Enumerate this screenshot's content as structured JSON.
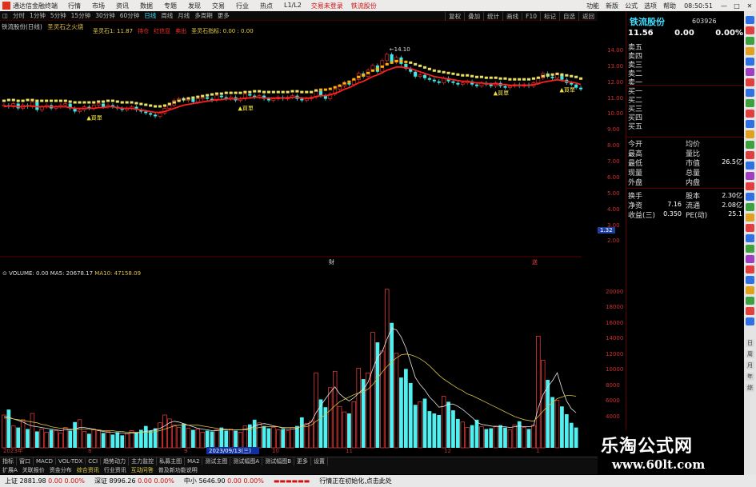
{
  "app": {
    "title": "通达信金融终端",
    "menu": [
      "行情",
      "市场",
      "资讯",
      "数据",
      "专题",
      "发现",
      "交易",
      "行业",
      "热点",
      "L1/L2"
    ],
    "login_links": [
      "交易未登录",
      "铁流股份"
    ],
    "right_menu": [
      "功能",
      "新版",
      "公式",
      "选项",
      "帮助"
    ],
    "clock": "08:50:51"
  },
  "period_tabs": [
    "分时",
    "1分钟",
    "5分钟",
    "15分钟",
    "30分钟",
    "60分钟",
    "日线",
    "周线",
    "月线",
    "多周期",
    "更多"
  ],
  "active_period": "日线",
  "chart_tools": [
    "复权",
    "叠加",
    "统计",
    "画线",
    "F10",
    "标记",
    "自选",
    "返回"
  ],
  "chart_header": {
    "title": "铁流股份(日线)",
    "formula": "圣灵石之火烧",
    "indicators": [
      {
        "label": "圣灵石1: 11.87",
        "color": "#e8d040"
      },
      {
        "label": "持仓",
        "color": "#ff3030"
      },
      {
        "label": "红信显",
        "color": "#ff3030"
      },
      {
        "label": "卖出",
        "color": "#ff3030"
      },
      {
        "label": "圣灵石指标: 0.00 : 0.00",
        "color": "#e8d040"
      }
    ]
  },
  "price_axis": [
    "14.00",
    "13.00",
    "12.00",
    "11.00",
    "10.00",
    "9.00",
    "8.00",
    "7.00",
    "6.00",
    "5.00",
    "4.00",
    "3.00",
    "2.00"
  ],
  "price_badge": "1.32",
  "annotations": {
    "high_label": "14.10",
    "buy_labels": [
      "▲買單",
      "▲買單",
      "▲買單",
      "▲買單"
    ],
    "event_markers": [
      "財",
      "送"
    ]
  },
  "volume_header": {
    "vol": "VOLUME: 0.00",
    "ma5": "MA5: 20678.17",
    "ma10": "MA10: 47158.09"
  },
  "volume_axis": [
    "20000",
    "18000",
    "16000",
    "14000",
    "12000",
    "10000",
    "8000",
    "6000",
    "4000"
  ],
  "time_axis": {
    "labels": [
      "2023年",
      "8",
      "9",
      "10",
      "11",
      "12",
      "1"
    ],
    "cursor_date": "2023/09/13(三)"
  },
  "bottom_tabs": [
    "指标",
    "窗口",
    "MACD",
    "VOL-TDX",
    "CCI",
    "趋势动力",
    "主力监控",
    "私募主图",
    "MA2",
    "测试主图",
    "测试幅图A",
    "测试幅图B",
    "更多",
    "设置"
  ],
  "bottom_tabs2": [
    {
      "label": "扩展A",
      "hl": false
    },
    {
      "label": "关联报价",
      "hl": false
    },
    {
      "label": "资金分布",
      "hl": false
    },
    {
      "label": "综合资讯",
      "hl": true
    },
    {
      "label": "行业资讯",
      "hl": false
    },
    {
      "label": "互动问答",
      "hl": true
    },
    {
      "label": "普及新功能说明",
      "hl": false
    }
  ],
  "status": {
    "sh": "上证 2881.98",
    "sh_chg": "0.00",
    "sh_pct": "0.00%",
    "sz": "深证 8996.26",
    "sz_chg": "0.00",
    "sz_pct": "0.00%",
    "zx": "中小 5646.90",
    "zx_chg": "0.00",
    "zx_pct": "0.00%",
    "message": "行情正在初始化,点击此处",
    "dashes": "▬▬▬▬▬▬"
  },
  "quote": {
    "name": "铁流股份",
    "code": "603926",
    "price": "11.56",
    "change": "0.00",
    "pct": "0.00%",
    "order_book": [
      "卖五",
      "卖四",
      "卖三",
      "卖二",
      "卖一",
      "买一",
      "买二",
      "买三",
      "买四",
      "买五"
    ],
    "stats_left": [
      "今开",
      "最高",
      "最低",
      "现量",
      "外盘"
    ],
    "stats_right": [
      "均价",
      "量比",
      "市值",
      "总量",
      "内盘"
    ],
    "market_value": "26.5亿",
    "extra": [
      {
        "l": "换手",
        "lv": "",
        "r": "股本",
        "rv": "2.30亿"
      },
      {
        "l": "净资",
        "lv": "7.16",
        "r": "流通",
        "rv": "2.08亿"
      },
      {
        "l": "收益(三)",
        "lv": "0.350",
        "r": "PE(动)",
        "rv": "25.1"
      }
    ]
  },
  "side_strip": [
    "日",
    "周",
    "月",
    "年",
    "综"
  ],
  "watermark": {
    "cn": "乐淘公式网",
    "url": "www.60lt.com"
  },
  "colors": {
    "up": "#ff3030",
    "down": "#40e8e8",
    "ma_price": "#e8e060",
    "ma_red": "#ff2020",
    "vol_up": "#ff4040",
    "vol_down": "#50f0f0",
    "ma5": "#e8e8e8",
    "ma10": "#d8c040"
  },
  "chart_data": {
    "type": "candlestick",
    "title": "铁流股份(日线)",
    "ylim": [
      1.32,
      14.6
    ],
    "price": [
      10.6,
      10.5,
      10.7,
      10.4,
      10.6,
      10.5,
      10.8,
      10.3,
      10.5,
      10.6,
      10.4,
      10.5,
      10.6,
      10.7,
      10.4,
      10.2,
      10.3,
      10.5,
      10.4,
      10.6,
      10.7,
      10.5,
      10.6,
      10.5,
      10.4,
      10.3,
      10.4,
      10.5,
      10.3,
      10.2,
      10.1,
      10.0,
      9.9,
      10.1,
      10.4,
      10.6,
      10.9,
      11.0,
      10.9,
      11.0,
      10.8,
      11.0,
      11.1,
      11.0,
      10.9,
      11.2,
      11.1,
      11.0,
      11.1,
      10.9,
      11.0,
      11.3,
      11.2,
      11.1,
      11.2,
      11.0,
      10.9,
      11.0,
      11.1,
      11.0,
      11.1,
      11.2,
      11.0,
      10.9,
      11.0,
      11.1,
      11.5,
      11.2,
      11.0,
      11.3,
      11.6,
      11.8,
      12.0,
      11.9,
      12.2,
      12.6,
      12.4,
      12.8,
      13.1,
      12.7,
      13.4,
      13.8,
      13.3,
      13.6,
      13.2,
      12.9,
      12.7,
      12.4,
      12.5,
      12.3,
      12.2,
      12.1,
      12.0,
      12.3,
      12.1,
      12.0,
      11.9,
      12.0,
      12.1,
      11.9,
      11.8,
      12.0,
      11.9,
      11.8,
      12.0,
      11.8,
      11.7,
      11.8,
      11.9,
      11.8,
      11.9,
      11.8,
      12.0,
      12.3,
      12.6,
      12.4,
      12.3,
      12.5,
      12.2,
      12.0,
      11.9,
      11.7,
      11.6
    ],
    "ma": [
      10.5,
      10.55,
      10.55,
      10.5,
      10.5,
      10.55,
      10.55,
      10.5,
      10.5,
      10.5,
      10.5,
      10.5,
      10.5,
      10.5,
      10.45,
      10.4,
      10.4,
      10.4,
      10.4,
      10.4,
      10.45,
      10.45,
      10.5,
      10.5,
      10.45,
      10.4,
      10.4,
      10.4,
      10.35,
      10.3,
      10.25,
      10.2,
      10.15,
      10.15,
      10.2,
      10.3,
      10.4,
      10.5,
      10.6,
      10.65,
      10.7,
      10.75,
      10.8,
      10.85,
      10.9,
      10.95,
      10.95,
      11.0,
      11.0,
      11.0,
      11.0,
      11.05,
      11.05,
      11.1,
      11.1,
      11.05,
      11.05,
      11.05,
      11.05,
      11.05,
      11.05,
      11.1,
      11.1,
      11.05,
      11.05,
      11.05,
      11.15,
      11.2,
      11.2,
      11.25,
      11.35,
      11.45,
      11.6,
      11.7,
      11.85,
      12.0,
      12.1,
      12.25,
      12.4,
      12.5,
      12.65,
      12.8,
      12.9,
      13.0,
      13.0,
      12.95,
      12.9,
      12.8,
      12.7,
      12.6,
      12.5,
      12.4,
      12.35,
      12.3,
      12.25,
      12.2,
      12.15,
      12.1,
      12.1,
      12.05,
      12.0,
      12.0,
      11.95,
      11.95,
      11.95,
      11.9,
      11.9,
      11.85,
      11.85,
      11.85,
      11.85,
      11.85,
      11.9,
      11.95,
      12.05,
      12.1,
      12.15,
      12.2,
      12.15,
      12.1,
      12.05,
      12.0,
      11.9
    ],
    "volume": [
      4200,
      4900,
      2800,
      2600,
      3600,
      2400,
      4400,
      2100,
      2400,
      2000,
      2300,
      2200,
      1900,
      2600,
      2200,
      3300,
      3600,
      2100,
      1800,
      2400,
      2200,
      1900,
      2100,
      1700,
      2000,
      1600,
      1800,
      2200,
      1900,
      2300,
      2800,
      2200,
      2500,
      3200,
      4200,
      3700,
      2900,
      2600,
      3100,
      2500,
      2300,
      2400,
      2000,
      2200,
      2100,
      2300,
      2600,
      2200,
      2400,
      2200,
      2000,
      2800,
      3000,
      3600,
      3200,
      2800,
      2500,
      2600,
      2300,
      2400,
      2200,
      2600,
      2800,
      3900,
      3100,
      3400,
      9600,
      6200,
      5200,
      7700,
      9800,
      5300,
      4600,
      4400,
      5900,
      10200,
      8800,
      9600,
      14800,
      13500,
      12400,
      20300,
      16000,
      12100,
      9000,
      10100,
      8300,
      5500,
      5900,
      6300,
      4700,
      4400,
      4200,
      6600,
      5900,
      4800,
      3700,
      3300,
      2600,
      2900,
      3600,
      2700,
      2400,
      2500,
      2800,
      2900,
      2600,
      2300,
      2900,
      3400,
      2600,
      2400,
      2900,
      14300,
      11200,
      8700,
      6500,
      6100,
      5300,
      4300,
      3200,
      2600
    ],
    "ma5": [
      4000,
      3900,
      3700,
      3500,
      3300,
      3000,
      2800,
      2700,
      2600,
      2500,
      2400,
      2300,
      2200,
      2300,
      2300,
      2400,
      2600,
      2600,
      2500,
      2400,
      2200,
      2100,
      2000,
      2000,
      1900,
      1900,
      1800,
      1900,
      1900,
      2000,
      2100,
      2200,
      2300,
      2500,
      2800,
      3200,
      3400,
      3300,
      3100,
      2900,
      2700,
      2500,
      2400,
      2300,
      2200,
      2200,
      2300,
      2300,
      2300,
      2300,
      2300,
      2400,
      2500,
      2800,
      3000,
      3100,
      3000,
      2800,
      2700,
      2500,
      2400,
      2400,
      2500,
      2800,
      3000,
      3300,
      4500,
      5400,
      6300,
      7100,
      7800,
      6900,
      6400,
      6000,
      6400,
      7000,
      7500,
      8400,
      10100,
      11600,
      12300,
      13900,
      15300,
      15100,
      14200,
      12800,
      10900,
      9000,
      8100,
      7400,
      6500,
      5900,
      5200,
      5300,
      5600,
      5600,
      5300,
      4900,
      4400,
      3900,
      3300,
      3000,
      2900,
      2800,
      2700,
      2700,
      2700,
      2600,
      2700,
      2800,
      2700,
      2700,
      2800,
      5100,
      6800,
      7800,
      8600,
      9600,
      7600,
      6000,
      5000,
      4500
    ],
    "ma10": [
      3800,
      3800,
      3700,
      3600,
      3500,
      3400,
      3300,
      3200,
      3000,
      2900,
      2700,
      2600,
      2500,
      2500,
      2400,
      2400,
      2400,
      2400,
      2400,
      2300,
      2300,
      2200,
      2200,
      2200,
      2100,
      2100,
      2000,
      2000,
      2000,
      2000,
      2000,
      2000,
      2100,
      2200,
      2400,
      2600,
      2800,
      2900,
      2900,
      2900,
      2900,
      2900,
      2800,
      2700,
      2600,
      2500,
      2400,
      2400,
      2300,
      2300,
      2300,
      2300,
      2400,
      2500,
      2600,
      2700,
      2700,
      2700,
      2700,
      2600,
      2600,
      2600,
      2600,
      2700,
      2700,
      2900,
      3400,
      3800,
      4300,
      4800,
      5400,
      5900,
      6200,
      6500,
      6800,
      7000,
      7200,
      7500,
      8100,
      8900,
      9700,
      10400,
      11000,
      11500,
      11900,
      12000,
      11900,
      11700,
      11400,
      11000,
      10500,
      9900,
      9300,
      8800,
      8400,
      8000,
      7600,
      7300,
      6900,
      6700,
      6400,
      6100,
      5800,
      5500,
      5200,
      4900,
      4600,
      4300,
      4000,
      3800,
      3600,
      3500,
      3400,
      4000,
      4700,
      5300,
      5800,
      6300,
      6500,
      6700,
      6700,
      6600
    ]
  }
}
